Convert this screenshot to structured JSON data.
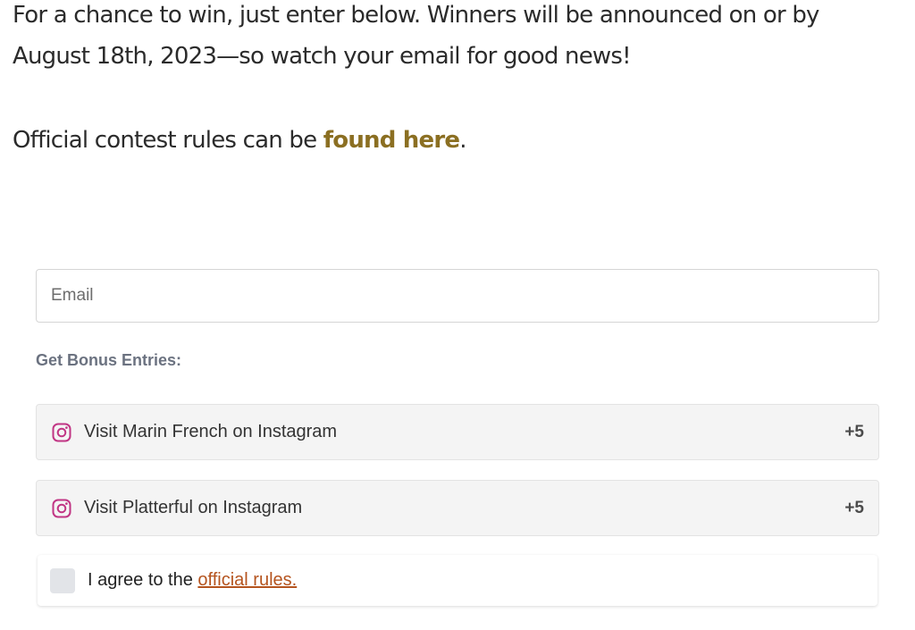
{
  "intro": {
    "text": "For a chance to win, just enter below. Winners will be announced on or by August 18th, 2023—so watch your email for good news!"
  },
  "rules": {
    "prefix": "Official contest rules can be ",
    "link_text": "found here",
    "suffix": "."
  },
  "form": {
    "email_placeholder": "Email",
    "bonus_heading": "Get Bonus Entries:",
    "bonus_entries": [
      {
        "label": "Visit Marin French on Instagram",
        "points": "+5",
        "icon": "instagram-icon"
      },
      {
        "label": "Visit Platterful on Instagram",
        "points": "+5",
        "icon": "instagram-icon"
      }
    ],
    "agree": {
      "prefix": "I agree to the ",
      "link_text": "official rules."
    }
  },
  "colors": {
    "link_gold": "#8b6f22",
    "link_orange": "#b5541f",
    "instagram": "#c13584"
  }
}
